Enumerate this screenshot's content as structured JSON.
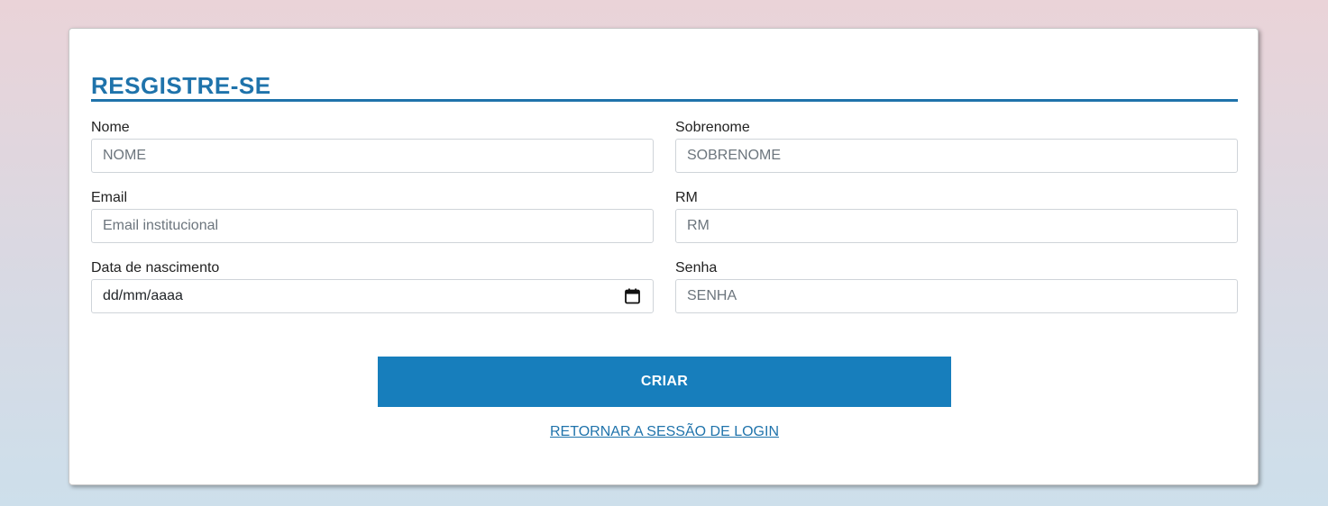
{
  "form": {
    "title": "RESGISTRE-SE",
    "accent_color": "#1f73ab",
    "fields": {
      "nome": {
        "label": "Nome",
        "placeholder": "NOME",
        "value": ""
      },
      "sobrenome": {
        "label": "Sobrenome",
        "placeholder": "SOBRENOME",
        "value": ""
      },
      "email": {
        "label": "Email",
        "placeholder": "Email institucional",
        "value": ""
      },
      "rm": {
        "label": "RM",
        "placeholder": "RM",
        "value": ""
      },
      "nascimento": {
        "label": "Data de nascimento",
        "display_value": "dd/mm/aaaa",
        "icon": "calendar-icon"
      },
      "senha": {
        "label": "Senha",
        "placeholder": "SENHA",
        "value": ""
      }
    },
    "submit_label": "CRIAR",
    "submit_color": "#177ebc",
    "back_link_label": "RETORNAR A SESSÃO DE LOGIN"
  }
}
